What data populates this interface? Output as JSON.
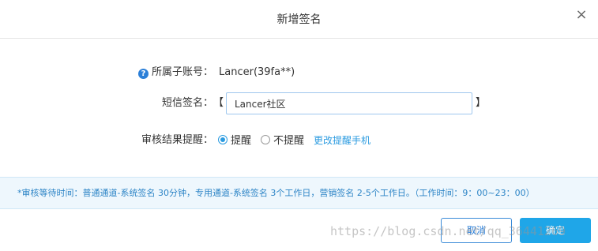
{
  "dialog": {
    "title": "新增签名",
    "close_icon": "×"
  },
  "form": {
    "account": {
      "label": "所属子账号：",
      "value": "Lancer(39fa**)",
      "help_icon": "?"
    },
    "signature": {
      "label": "短信签名：",
      "bracket_left": "【",
      "bracket_right": "】",
      "value": "Lancer社区"
    },
    "review": {
      "label": "审核结果提醒：",
      "options": [
        "提醒",
        "不提醒"
      ],
      "selected": "提醒",
      "change_link": "更改提醒手机"
    }
  },
  "notice": "*审核等待时间：普通通道-系统签名 30分钟，专用通道-系统签名 3个工作日，营销签名 2-5个工作日。（工作时间：9：00~23：00）",
  "footer": {
    "cancel_label": "取消",
    "ok_label": "确定"
  },
  "watermark": "https://blog.csdn.net/qq_36441269",
  "colors": {
    "accent": "#1fa6e8",
    "link": "#2b9be0",
    "notice_bg": "#eef7fd",
    "notice_text": "#2c84c6"
  }
}
